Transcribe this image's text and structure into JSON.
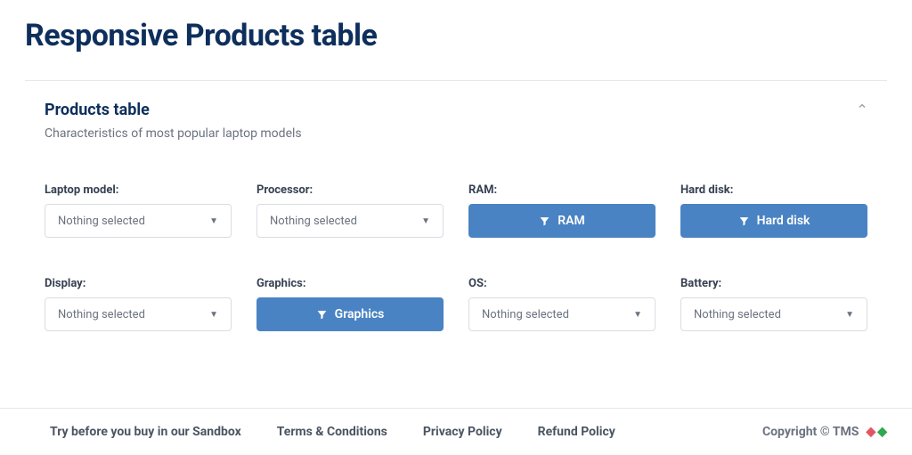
{
  "title": "Responsive Products table",
  "panel": {
    "heading": "Products table",
    "sub": "Characteristics of most popular laptop models"
  },
  "placeholders": {
    "nothing": "Nothing selected"
  },
  "filters": {
    "laptop": {
      "label": "Laptop model:"
    },
    "processor": {
      "label": "Processor:"
    },
    "ram": {
      "label": "RAM:",
      "button": "RAM"
    },
    "hdd": {
      "label": "Hard disk:",
      "button": "Hard disk"
    },
    "display": {
      "label": "Display:"
    },
    "graphics": {
      "label": "Graphics:",
      "button": "Graphics"
    },
    "os": {
      "label": "OS:"
    },
    "battery": {
      "label": "Battery:"
    }
  },
  "footer": {
    "links": {
      "sandbox": "Try before you buy in our Sandbox",
      "terms": "Terms & Conditions",
      "privacy": "Privacy Policy",
      "refund": "Refund Policy"
    },
    "copyright": "Copyright © TMS"
  }
}
